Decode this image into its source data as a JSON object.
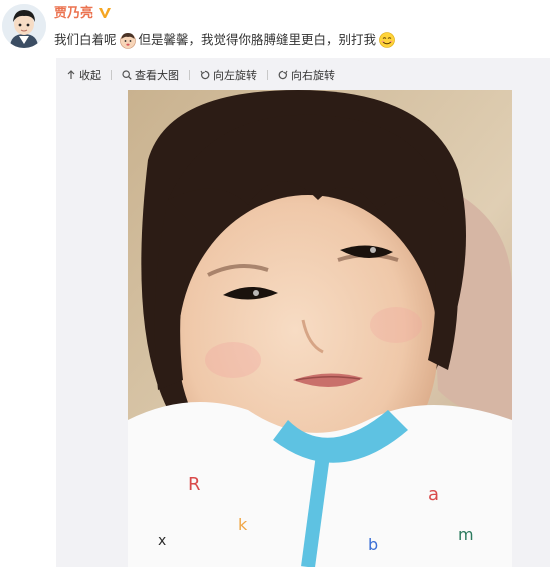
{
  "post": {
    "username": "贾乃亮",
    "text_part1": "我们白着呢",
    "text_part2": "但是馨馨，我觉得你胳膊缝里更白，别打我"
  },
  "toolbar": {
    "collapse": "收起",
    "view_large": "查看大图",
    "rotate_left": "向左旋转",
    "rotate_right": "向右旋转"
  },
  "icons": {
    "avatar": "cartoon-avatar-icon",
    "verify": "verified-v-icon",
    "emoji1": "baby-face-emoji-icon",
    "emoji2": "shy-smile-emoji-icon"
  },
  "colors": {
    "username": "#eb7350",
    "verify": "#f5a623",
    "collar": "#5ec2e2"
  }
}
